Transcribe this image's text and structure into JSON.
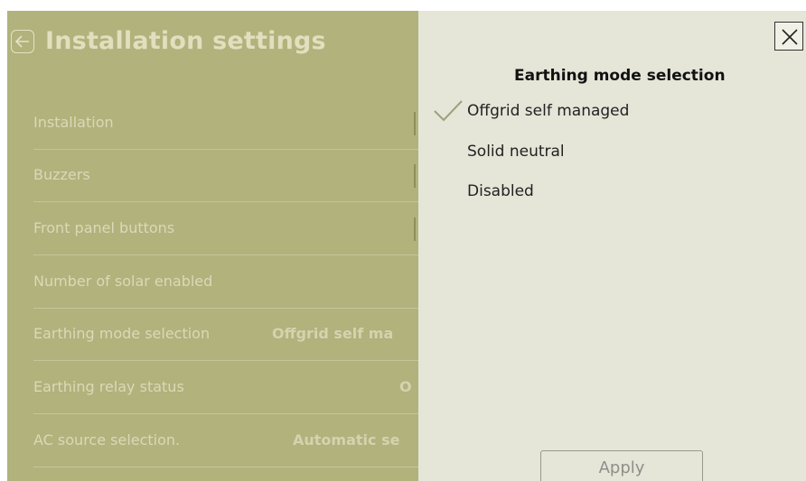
{
  "page": {
    "title": "Installation settings"
  },
  "settings_rows": [
    {
      "label": "Installation",
      "value": ""
    },
    {
      "label": "Buzzers",
      "value": ""
    },
    {
      "label": "Front panel buttons",
      "value": ""
    },
    {
      "label": "Number of solar enabled",
      "value": ""
    },
    {
      "label": "Earthing mode selection",
      "value": "Offgrid self ma"
    },
    {
      "label": "Earthing relay status",
      "value": "O"
    },
    {
      "label": "AC source selection.",
      "value": "Automatic se"
    }
  ],
  "dialog": {
    "title": "Earthing mode selection",
    "options": [
      {
        "label": "Offgrid self managed",
        "selected": true
      },
      {
        "label": "Solid neutral",
        "selected": false
      },
      {
        "label": "Disabled",
        "selected": false
      }
    ],
    "apply_label": "Apply"
  },
  "icons": {
    "back": "arrow-left-icon",
    "close": "close-icon",
    "check": "checkmark-icon"
  },
  "colors": {
    "dimmed_background": "#b1b27c",
    "panel_background": "#e5e5d8",
    "check_color": "#9aa17a"
  }
}
